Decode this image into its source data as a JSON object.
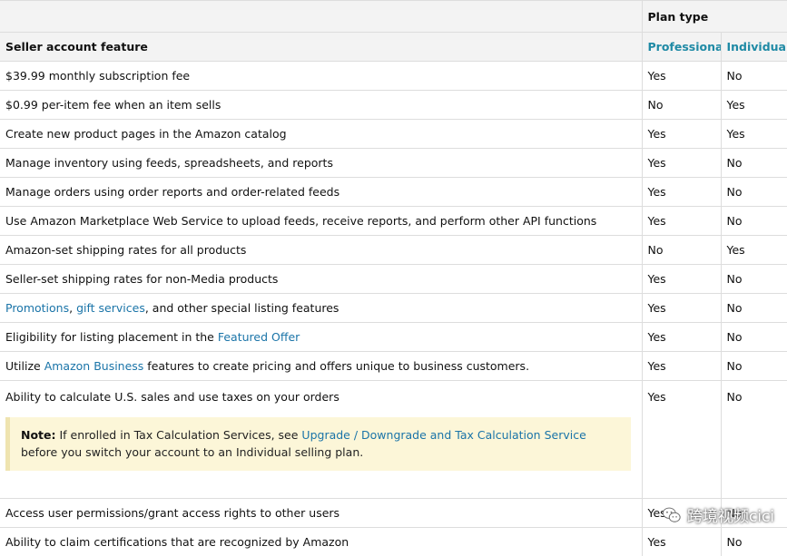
{
  "table": {
    "plan_type_label": "Plan type",
    "feature_header": "Seller account feature",
    "professional_label": "Professional",
    "individual_label": "Individual",
    "rows": [
      {
        "feature": "$39.99 monthly subscription fee",
        "professional": "Yes",
        "individual": "No"
      },
      {
        "feature": "$0.99 per-item fee when an item sells",
        "professional": "No",
        "individual": "Yes"
      },
      {
        "feature": "Create new product pages in the Amazon catalog",
        "professional": "Yes",
        "individual": "Yes"
      },
      {
        "feature": "Manage inventory using feeds, spreadsheets, and reports",
        "professional": "Yes",
        "individual": "No"
      },
      {
        "feature": "Manage orders using order reports and order-related feeds",
        "professional": "Yes",
        "individual": "No"
      },
      {
        "feature": "Use Amazon Marketplace Web Service to upload feeds, receive reports, and perform other API functions",
        "professional": "Yes",
        "individual": "No"
      },
      {
        "feature": "Amazon-set shipping rates for all products",
        "professional": "No",
        "individual": "Yes"
      },
      {
        "feature": "Seller-set shipping rates for non-Media products",
        "professional": "Yes",
        "individual": "No"
      },
      {
        "feature_link1": "Promotions",
        "feature_sep": ", ",
        "feature_link2": "gift services",
        "feature_rest": ", and other special listing features",
        "professional": "Yes",
        "individual": "No"
      },
      {
        "feature_pre": "Eligibility for listing placement in the ",
        "feature_link": "Featured Offer",
        "professional": "Yes",
        "individual": "No"
      },
      {
        "feature_pre": "Utilize ",
        "feature_link": "Amazon Business",
        "feature_post": " features to create pricing and offers unique to business customers.",
        "professional": "Yes",
        "individual": "No"
      },
      {
        "feature": "Ability to calculate U.S. sales and use taxes on your orders",
        "professional": "Yes",
        "individual": "No"
      },
      {
        "feature": "Access user permissions/grant access rights to other users",
        "professional": "Yes",
        "individual": "No"
      },
      {
        "feature": "Ability to claim certifications that are recognized by Amazon",
        "professional": "Yes",
        "individual": "No"
      }
    ],
    "note": {
      "label": "Note:",
      "text_pre": " If enrolled in Tax Calculation Services, see ",
      "link": "Upgrade / Downgrade and Tax Calculation Service",
      "text_post": " before you switch your account to an Individual selling plan."
    }
  },
  "watermark": {
    "text": "跨境视频cici",
    "icon": "wechat-icon"
  }
}
